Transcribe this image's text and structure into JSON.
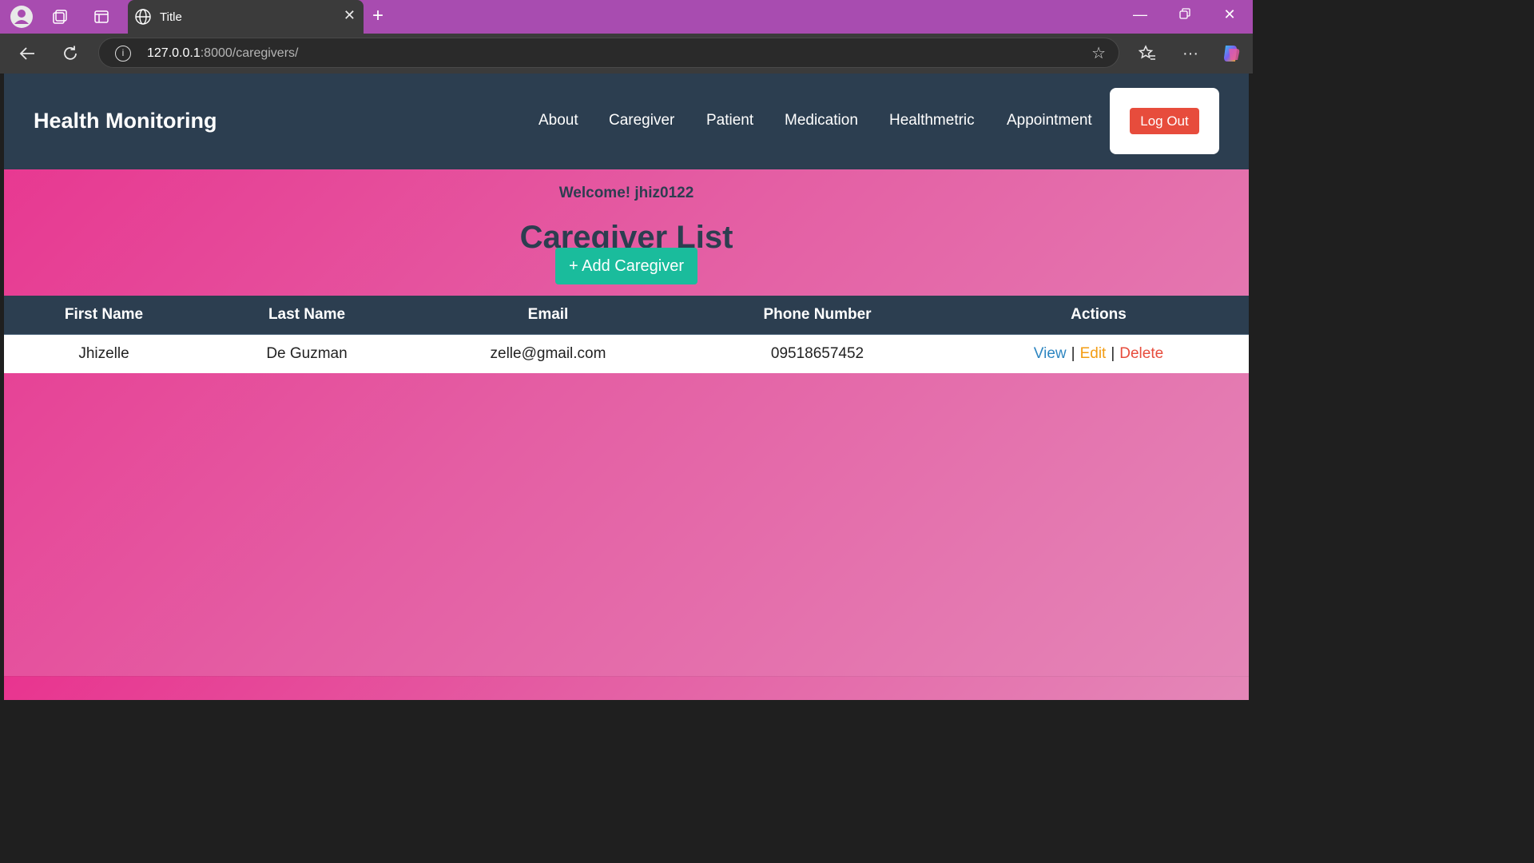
{
  "browser": {
    "tab_title": "Title",
    "url_host": "127.0.0.1",
    "url_path": ":8000/caregivers/"
  },
  "navbar": {
    "brand": "Health Monitoring",
    "links": [
      "About",
      "Caregiver",
      "Patient",
      "Medication",
      "Healthmetric",
      "Appointment"
    ],
    "logout_label": "Log Out"
  },
  "main": {
    "welcome": "Welcome! jhiz0122",
    "title": "Caregiver List",
    "add_button": "+ Add Caregiver"
  },
  "table": {
    "headers": [
      "First Name",
      "Last Name",
      "Email",
      "Phone Number",
      "Actions"
    ],
    "rows": [
      {
        "first_name": "Jhizelle",
        "last_name": "De Guzman",
        "email": "zelle@gmail.com",
        "phone": "09518657452",
        "actions": [
          "View",
          "Edit",
          "Delete"
        ],
        "separator": "|"
      }
    ]
  },
  "colors": {
    "navbar": "#2c3e50",
    "logout": "#e74c3c",
    "add": "#1abc9c",
    "view": "#2e86c1",
    "edit": "#f39c12",
    "delete": "#e74c3c"
  },
  "icons": {
    "profile": "profile-icon",
    "workspaces": "workspaces-icon",
    "tab_actions": "tab-actions-icon",
    "globe": "globe-icon",
    "back": "back-arrow-icon",
    "reload": "reload-icon",
    "info": "info-icon",
    "favorite": "star-icon",
    "favorites": "favorites-icon",
    "more": "more-icon",
    "copilot": "copilot-icon"
  }
}
